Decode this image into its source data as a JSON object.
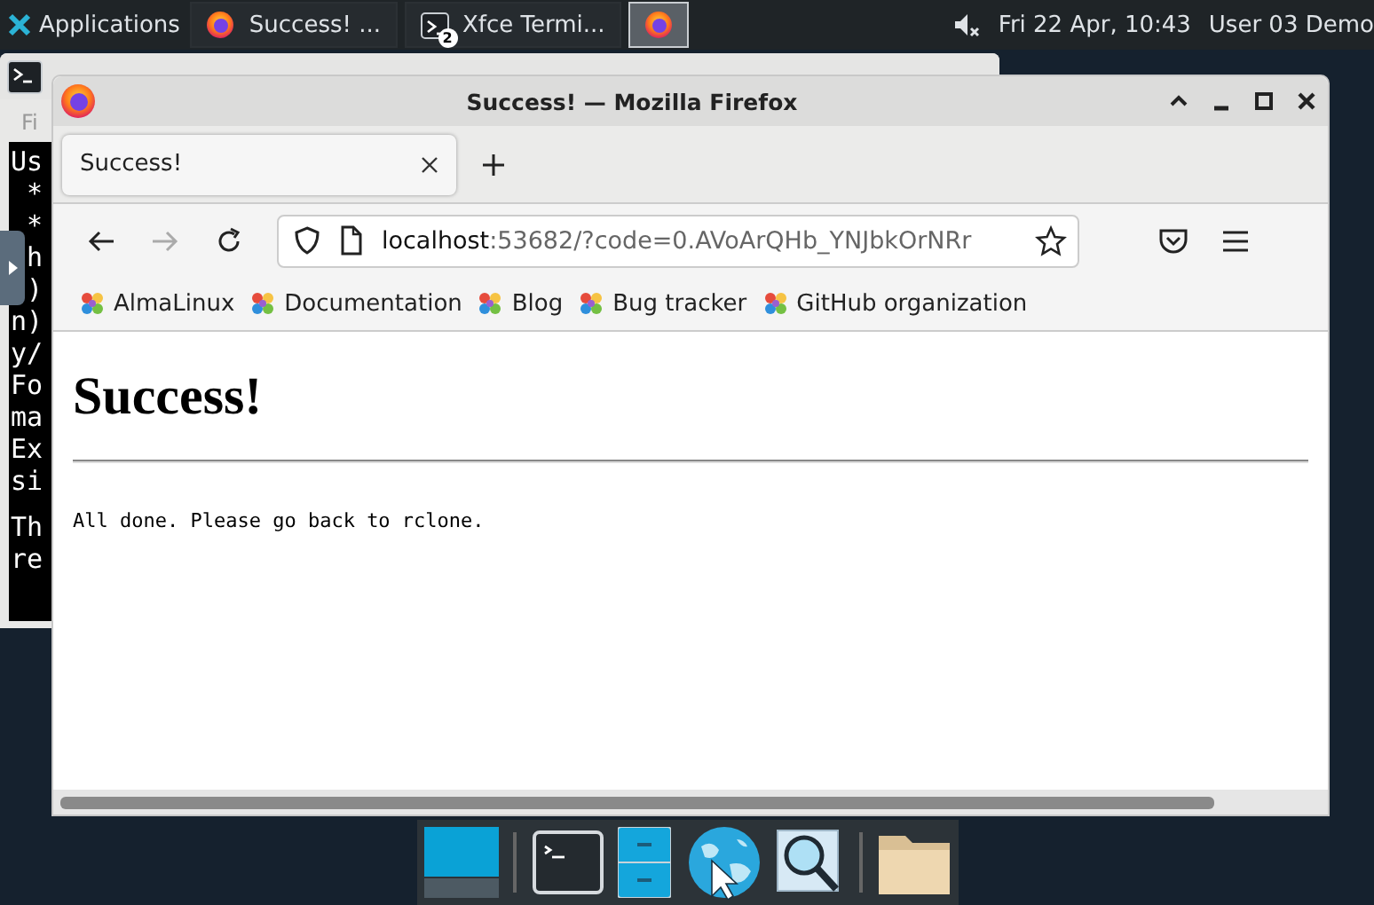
{
  "top_panel": {
    "applications": "Applications",
    "tasks": [
      {
        "kind": "firefox",
        "label": "Success! ...",
        "selected": false
      },
      {
        "kind": "terminal",
        "label": "Xfce Termi...",
        "badge": "2",
        "selected": false
      },
      {
        "kind": "firefox",
        "selected": true
      }
    ],
    "volume_muted": true,
    "clock": "Fri 22 Apr, 10:43",
    "user": "User 03 Demo"
  },
  "terminal": {
    "menu": "Fi",
    "paragraphs": [
      [
        "Us",
        " *",
        " *",
        " h",
        " )",
        "n)",
        "y/",
        "Fo",
        "ma",
        "Ex",
        "si"
      ],
      [
        "Th",
        "re"
      ]
    ]
  },
  "firefox": {
    "window_title": "Success! — Mozilla Firefox",
    "tabs": [
      {
        "label": "Success!",
        "selected": true
      }
    ],
    "back_disabled": false,
    "forward_disabled": true,
    "url": {
      "host": "localhost",
      "rest": ":53682/?code=0.AVoArQHb_YNJbkOrNRr"
    },
    "bookmarks": [
      "AlmaLinux",
      "Documentation",
      "Blog",
      "Bug tracker",
      "GitHub organization"
    ],
    "page": {
      "heading": "Success!",
      "message": "All done. Please go back to rclone."
    }
  },
  "dock": [
    {
      "kind": "desktop"
    },
    {
      "kind": "separator"
    },
    {
      "kind": "terminal"
    },
    {
      "kind": "files"
    },
    {
      "kind": "browser"
    },
    {
      "kind": "search"
    },
    {
      "kind": "separator"
    },
    {
      "kind": "folder"
    }
  ]
}
